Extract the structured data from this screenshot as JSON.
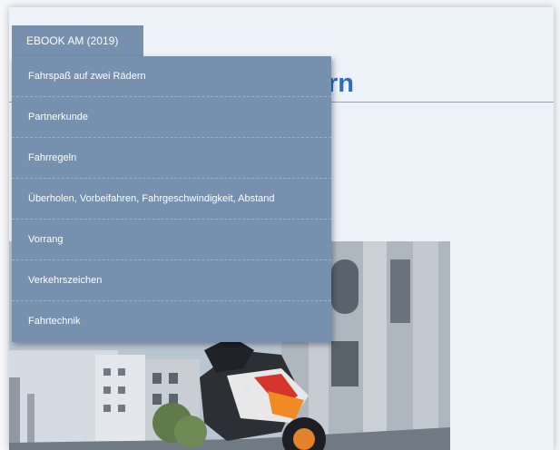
{
  "menu": {
    "tab_label": "EBOOK AM (2019)",
    "items": [
      {
        "label": "Fahrspaß auf zwei Rädern"
      },
      {
        "label": "Partnerkunde"
      },
      {
        "label": "Fahrregeln"
      },
      {
        "label": "Überholen, Vorbeifahren, Fahrgeschwindigkeit, Abstand"
      },
      {
        "label": "Vorrang"
      },
      {
        "label": "Verkehrszeichen"
      },
      {
        "label": "Fahrtechnik"
      }
    ]
  },
  "page": {
    "title_visible_fragment": "rn"
  },
  "colors": {
    "menu_background": "#7690ae",
    "title_color": "#2e6fb4"
  }
}
